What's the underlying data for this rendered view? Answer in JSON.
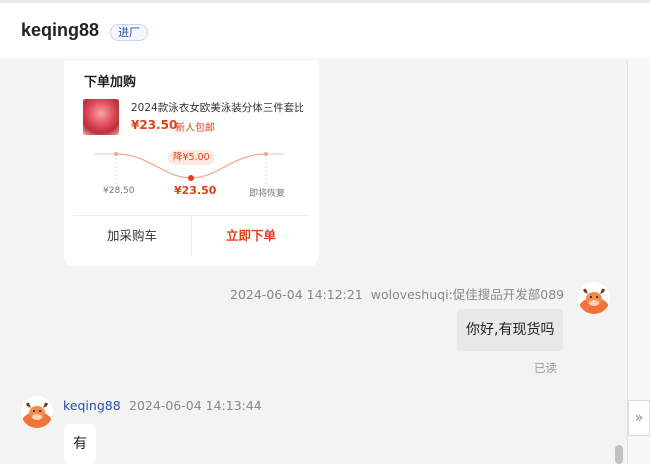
{
  "header": {
    "contact_name": "keqing88",
    "tag": "进厂"
  },
  "order_card": {
    "title": "下单加购",
    "product_name": "2024款泳衣女欧美泳装分体三件套比",
    "price": "¥23.50",
    "new_user_tag": "新人包邮",
    "discount_label": "降¥5.00",
    "price_points": {
      "original": "¥28.50",
      "current": "¥23.50",
      "restore": "即将恢复"
    },
    "add_cart_label": "加采购车",
    "buy_now_label": "立即下单"
  },
  "my_message": {
    "time": "2024-06-04 14:12:21",
    "sender": "woloveshuqi:促佳搜品开发部089",
    "text": "你好,有现货吗",
    "read_status": "已读"
  },
  "their_message": {
    "sender": "keqing88",
    "time": "2024-06-04 14:13:44",
    "text": "有"
  },
  "icons": {
    "avatar": "bull-avatar-icon",
    "expand": "double-chevron-right-icon"
  },
  "colors": {
    "accent": "#e0411b",
    "link": "#2b4fa8"
  }
}
